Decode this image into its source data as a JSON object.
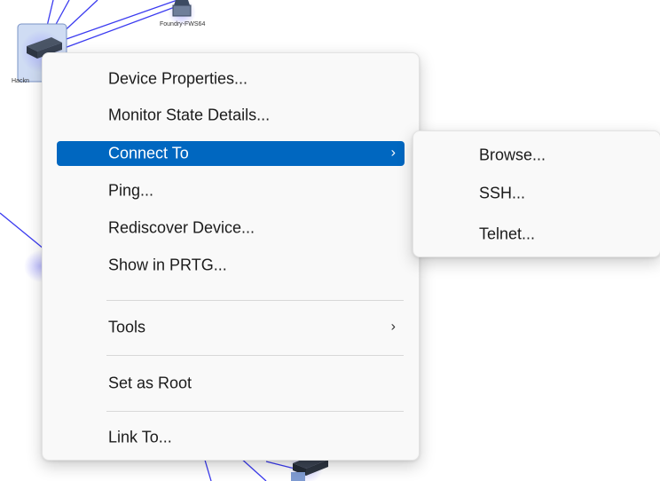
{
  "map": {
    "devices": [
      {
        "id": "top-device",
        "label": "Foundry-FWS64"
      },
      {
        "id": "left-device",
        "label": "Hackn"
      }
    ]
  },
  "context_menu": {
    "items": [
      {
        "label": "Device Properties...",
        "has_submenu": false
      },
      {
        "label": "Monitor State Details...",
        "has_submenu": false
      },
      {
        "label": "Connect To",
        "has_submenu": true,
        "highlighted": true
      },
      {
        "label": "Ping...",
        "has_submenu": false
      },
      {
        "label": "Rediscover Device...",
        "has_submenu": false
      },
      {
        "label": "Show in PRTG...",
        "has_submenu": false
      },
      {
        "label": "Tools",
        "has_submenu": true
      },
      {
        "label": "Set as Root",
        "has_submenu": false
      },
      {
        "label": "Link To...",
        "has_submenu": false
      }
    ],
    "chevron": "›"
  },
  "submenu": {
    "items": [
      {
        "label": "Browse..."
      },
      {
        "label": "SSH..."
      },
      {
        "label": "Telnet..."
      }
    ]
  },
  "colors": {
    "highlight": "#0067c0",
    "link_line": "#3b3bf0",
    "menu_background": "#f9f9f9"
  }
}
